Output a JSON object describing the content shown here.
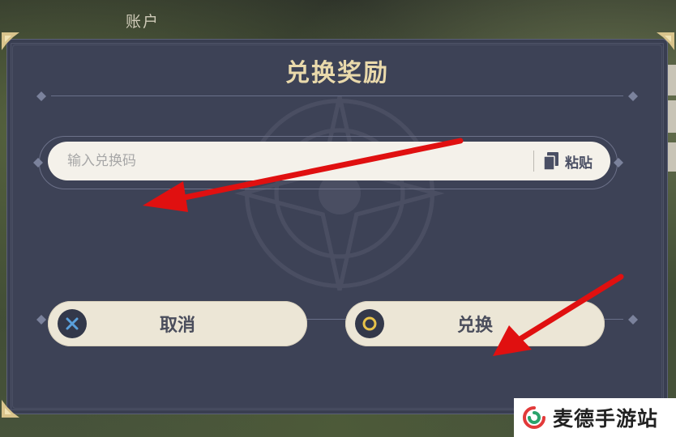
{
  "background": {
    "title": "账户"
  },
  "dialog": {
    "title": "兑换奖励",
    "code_input": {
      "placeholder": "输入兑换码",
      "value": ""
    },
    "paste_label": "粘贴",
    "cancel_button": {
      "label": "取消",
      "icon": "x-icon",
      "icon_color": "#5aa0dc"
    },
    "redeem_button": {
      "label": "兑换",
      "icon": "circle-icon",
      "icon_color": "#e8c34a"
    }
  },
  "watermark": {
    "text": "麦德手游站"
  },
  "colors": {
    "dialog_bg": "#3d4256",
    "title_gold": "#e9d9ab",
    "button_bg": "#ece6d6",
    "annotation_arrow": "#e01010"
  }
}
